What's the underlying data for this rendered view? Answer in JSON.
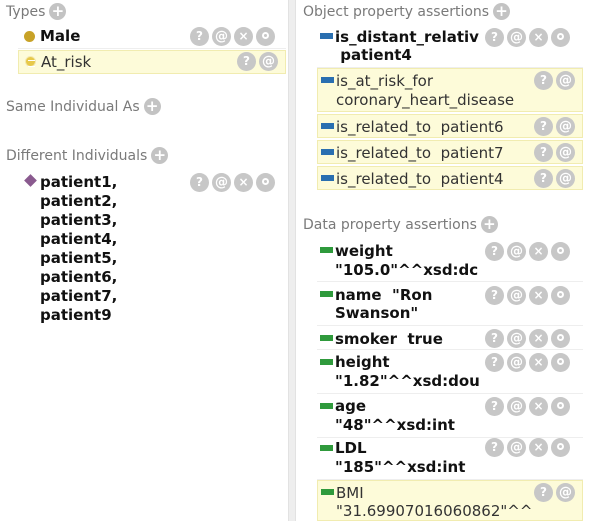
{
  "left": {
    "types": {
      "header": "Types",
      "items": [
        {
          "label": "Male",
          "bold": true
        },
        {
          "label": "At_risk",
          "bold": false
        }
      ]
    },
    "same_individual": {
      "header": "Same Individual As"
    },
    "different_individuals": {
      "header": "Different Individuals",
      "lines": [
        "patient1,",
        "patient2,",
        "patient3,",
        "patient4,",
        "patient5,",
        "patient6,",
        "patient7,",
        "patient9"
      ]
    }
  },
  "right": {
    "object_props": {
      "header": "Object property assertions",
      "items": [
        {
          "lines": [
            "is_distant_relativ",
            " patient4"
          ],
          "bold": true
        },
        {
          "lines": [
            "is_at_risk_for",
            "coronary_heart_disease"
          ],
          "bold": false
        },
        {
          "lines": [
            "is_related_to  patient6"
          ],
          "bold": false
        },
        {
          "lines": [
            "is_related_to  patient7"
          ],
          "bold": false
        },
        {
          "lines": [
            "is_related_to  patient4"
          ],
          "bold": false
        }
      ]
    },
    "data_props": {
      "header": "Data property assertions",
      "items": [
        {
          "lines": [
            "weight",
            "\"105.0\"^^xsd:dc"
          ],
          "bold": true
        },
        {
          "lines": [
            "name  \"Ron",
            "Swanson\""
          ],
          "bold": true
        },
        {
          "lines": [
            "smoker  true"
          ],
          "bold": true
        },
        {
          "lines": [
            "height",
            "\"1.82\"^^xsd:dou"
          ],
          "bold": true
        },
        {
          "lines": [
            "age",
            "\"48\"^^xsd:int"
          ],
          "bold": true
        },
        {
          "lines": [
            "LDL",
            "\"185\"^^xsd:int"
          ],
          "bold": true
        },
        {
          "lines": [
            "BMI",
            "\"31.69907016060862\"^^"
          ],
          "bold": false
        }
      ]
    }
  },
  "buttons": {
    "help": "?",
    "annotate": "@",
    "delete": "×",
    "edit": "o"
  },
  "plus_symbol": "+",
  "colors": {
    "class_dot": "#c8a227",
    "individual": "#8a5a8f",
    "object_property": "#2a6fb0",
    "data_property": "#2f9a3c",
    "inferred_bg": "#fdfbd9"
  }
}
